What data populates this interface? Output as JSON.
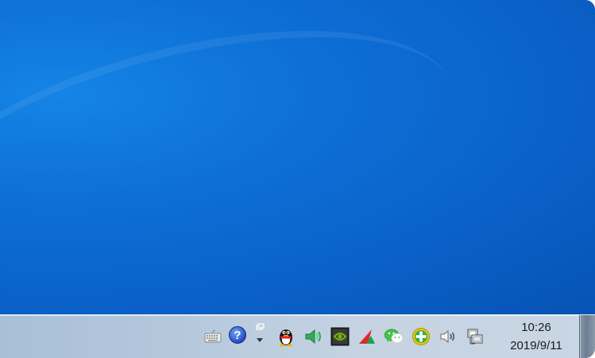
{
  "clock": {
    "time": "10:26",
    "date": "2019/9/11"
  },
  "tray_icons": [
    "keyboard-icon",
    "help-icon",
    "show-hidden-icons-icon",
    "qq-penguin-icon",
    "green-speaker-app-icon",
    "nvidia-icon",
    "red-green-arrow-app-icon",
    "wechat-icon",
    "green-plus-security-icon",
    "volume-icon",
    "network-icon"
  ],
  "colors": {
    "desktop": "#0d6fd6",
    "taskbar": "#b9cbe0",
    "clock_text": "#1a1a1a"
  }
}
